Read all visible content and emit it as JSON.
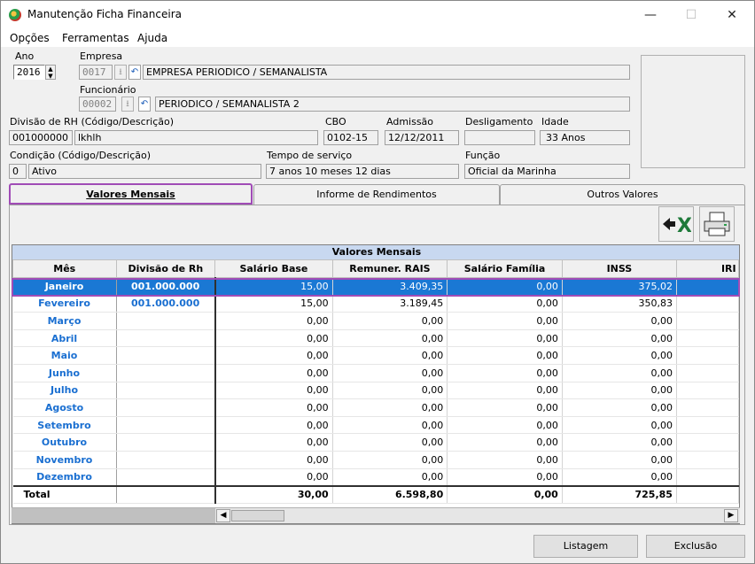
{
  "window": {
    "title": "Manutenção Ficha Financeira",
    "minimize": "—",
    "maximize": "☐",
    "close": "✕"
  },
  "menu": [
    "Opções",
    "Ferramentas",
    "Ajuda"
  ],
  "form": {
    "ano_label": "Ano",
    "ano_value": "2016",
    "empresa_label": "Empresa",
    "empresa_code": "0017",
    "empresa_name": "EMPRESA PERIODICO / SEMANALISTA",
    "funcionario_label": "Funcionário",
    "funcionario_code": "00002",
    "funcionario_name": "PERIODICO / SEMANALISTA 2",
    "divisao_label": "Divisão de RH (Código/Descrição)",
    "divisao_code": "001000000",
    "divisao_desc": "lkhlh",
    "cbo_label": "CBO",
    "cbo_value": "0102-15",
    "admissao_label": "Admissão",
    "admissao_value": "12/12/2011",
    "desligamento_label": "Desligamento",
    "desligamento_value": "",
    "idade_label": "Idade",
    "idade_value": "33 Anos",
    "condicao_label": "Condição (Código/Descrição)",
    "condicao_code": "0",
    "condicao_desc": "Ativo",
    "tempo_label": "Tempo de serviço",
    "tempo_value": "7 anos 10 meses 12 dias",
    "funcao_label": "Função",
    "funcao_value": "Oficial da Marinha"
  },
  "tabs": [
    "Valores Mensais",
    "Informe de Rendimentos",
    "Outros Valores"
  ],
  "grid": {
    "title": "Valores Mensais",
    "columns": [
      "Mês",
      "Divisão de Rh",
      "Salário Base",
      "Remuner. RAIS",
      "Salário Família",
      "INSS",
      "IRI"
    ],
    "rows": [
      {
        "mes": "Janeiro",
        "div": "001.000.000",
        "sal": "15,00",
        "rais": "3.409,35",
        "fam": "0,00",
        "inss": "375,02"
      },
      {
        "mes": "Fevereiro",
        "div": "001.000.000",
        "sal": "15,00",
        "rais": "3.189,45",
        "fam": "0,00",
        "inss": "350,83"
      },
      {
        "mes": "Março",
        "div": "",
        "sal": "0,00",
        "rais": "0,00",
        "fam": "0,00",
        "inss": "0,00"
      },
      {
        "mes": "Abril",
        "div": "",
        "sal": "0,00",
        "rais": "0,00",
        "fam": "0,00",
        "inss": "0,00"
      },
      {
        "mes": "Maio",
        "div": "",
        "sal": "0,00",
        "rais": "0,00",
        "fam": "0,00",
        "inss": "0,00"
      },
      {
        "mes": "Junho",
        "div": "",
        "sal": "0,00",
        "rais": "0,00",
        "fam": "0,00",
        "inss": "0,00"
      },
      {
        "mes": "Julho",
        "div": "",
        "sal": "0,00",
        "rais": "0,00",
        "fam": "0,00",
        "inss": "0,00"
      },
      {
        "mes": "Agosto",
        "div": "",
        "sal": "0,00",
        "rais": "0,00",
        "fam": "0,00",
        "inss": "0,00"
      },
      {
        "mes": "Setembro",
        "div": "",
        "sal": "0,00",
        "rais": "0,00",
        "fam": "0,00",
        "inss": "0,00"
      },
      {
        "mes": "Outubro",
        "div": "",
        "sal": "0,00",
        "rais": "0,00",
        "fam": "0,00",
        "inss": "0,00"
      },
      {
        "mes": "Novembro",
        "div": "",
        "sal": "0,00",
        "rais": "0,00",
        "fam": "0,00",
        "inss": "0,00"
      },
      {
        "mes": "Dezembro",
        "div": "",
        "sal": "0,00",
        "rais": "0,00",
        "fam": "0,00",
        "inss": "0,00"
      }
    ],
    "total": {
      "mes": "Total",
      "div": "",
      "sal": "30,00",
      "rais": "6.598,80",
      "fam": "0,00",
      "inss": "725,85"
    }
  },
  "buttons": {
    "listagem": "Listagem",
    "exclusao": "Exclusão"
  },
  "icons": {
    "excel": "excel-export-icon",
    "printer": "printer-icon"
  }
}
